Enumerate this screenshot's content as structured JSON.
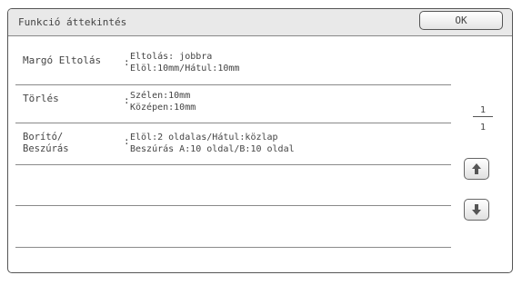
{
  "window": {
    "title": "Funkció áttekintés",
    "ok_label": "OK"
  },
  "rows": [
    {
      "name": "Margó Eltolás",
      "colon": ":",
      "lines": [
        "Eltolás: jobbra",
        "Elöl:10mm/Hátul:10mm"
      ]
    },
    {
      "name": "Törlés",
      "colon": ":",
      "lines": [
        "Szélen:10mm",
        "Középen:10mm"
      ]
    },
    {
      "name": "Borító/\nBeszúrás",
      "colon": ":",
      "lines": [
        "Elöl:2 oldalas/Hátul:közlap",
        "Beszúrás A:10 oldal/B:10 oldal"
      ]
    },
    {
      "name": "",
      "colon": "",
      "lines": []
    },
    {
      "name": "",
      "colon": "",
      "lines": []
    },
    {
      "name": "",
      "colon": "",
      "lines": []
    }
  ],
  "pager": {
    "current": "1",
    "total": "1"
  },
  "icons": {
    "scroll_up": "arrow-up-icon",
    "scroll_down": "arrow-down-icon"
  }
}
